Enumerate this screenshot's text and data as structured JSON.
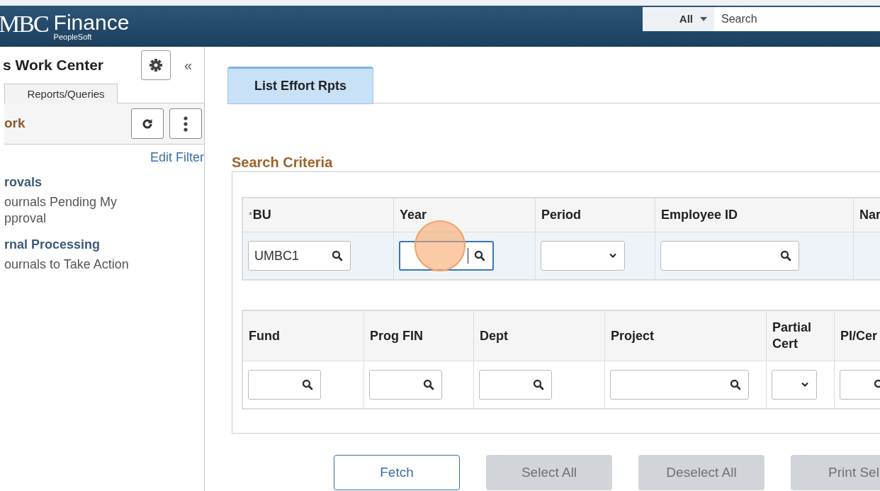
{
  "header": {
    "logo_prefix": "MBC",
    "logo": "Finance",
    "logo_sub": "PeopleSoft",
    "search_scope": "All",
    "search_placeholder": "Search"
  },
  "sidebar": {
    "title": "s Work Center",
    "collapse": "«",
    "tabs": [
      {
        "label": "Reports/Queries",
        "selected": false
      }
    ],
    "section": "ork",
    "edit_filters": "Edit Filter",
    "groups": [
      {
        "title": "rovals",
        "items": [
          "ournals Pending My pproval"
        ]
      },
      {
        "title": "rnal Processing",
        "items": [
          "ournals to Take Action"
        ]
      }
    ]
  },
  "tabs": [
    {
      "label": "List Effort Rpts",
      "selected": true
    }
  ],
  "search_criteria": {
    "title": "Search Criteria",
    "grid_1": {
      "columns": [
        {
          "label": "BU",
          "required_mark": "*"
        },
        {
          "label": "Year"
        },
        {
          "label": "Period"
        },
        {
          "label": "Employee ID"
        },
        {
          "label": "Nar"
        }
      ],
      "fields": [
        {
          "kind": "lookup",
          "value": "UMBC1",
          "focused": false
        },
        {
          "kind": "lookup",
          "focused": true
        },
        {
          "kind": "dropdown",
          "focused": false
        },
        {
          "kind": "lookup",
          "focused": false
        },
        {
          "kind": "empty"
        }
      ]
    },
    "grid_2": {
      "columns": [
        {
          "label": "Fund"
        },
        {
          "label": "Prog FIN"
        },
        {
          "label": "Dept"
        },
        {
          "label": "Project"
        },
        {
          "label": "Partial Cert"
        },
        {
          "label": "PI/Cer"
        }
      ],
      "fields": [
        {
          "kind": "lookup",
          "focused": false
        },
        {
          "kind": "lookup",
          "focused": false
        },
        {
          "kind": "lookup",
          "focused": false
        },
        {
          "kind": "lookup",
          "focused": false
        },
        {
          "kind": "dropdown",
          "focused": false
        },
        {
          "kind": "lookup",
          "focused": false
        }
      ]
    }
  },
  "buttons": [
    {
      "label": "Fetch",
      "disabled": false
    },
    {
      "label": "Select All",
      "disabled": true
    },
    {
      "label": "Deselect All",
      "disabled": true
    },
    {
      "label": "Print Sel",
      "disabled": true
    }
  ]
}
